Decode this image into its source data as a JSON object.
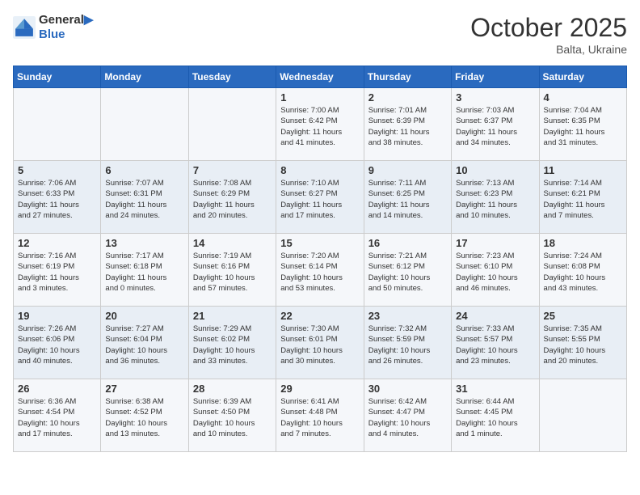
{
  "header": {
    "logo_line1": "General",
    "logo_line2": "Blue",
    "month": "October 2025",
    "location": "Balta, Ukraine"
  },
  "weekdays": [
    "Sunday",
    "Monday",
    "Tuesday",
    "Wednesday",
    "Thursday",
    "Friday",
    "Saturday"
  ],
  "weeks": [
    [
      {
        "day": "",
        "info": ""
      },
      {
        "day": "",
        "info": ""
      },
      {
        "day": "",
        "info": ""
      },
      {
        "day": "1",
        "info": "Sunrise: 7:00 AM\nSunset: 6:42 PM\nDaylight: 11 hours\nand 41 minutes."
      },
      {
        "day": "2",
        "info": "Sunrise: 7:01 AM\nSunset: 6:39 PM\nDaylight: 11 hours\nand 38 minutes."
      },
      {
        "day": "3",
        "info": "Sunrise: 7:03 AM\nSunset: 6:37 PM\nDaylight: 11 hours\nand 34 minutes."
      },
      {
        "day": "4",
        "info": "Sunrise: 7:04 AM\nSunset: 6:35 PM\nDaylight: 11 hours\nand 31 minutes."
      }
    ],
    [
      {
        "day": "5",
        "info": "Sunrise: 7:06 AM\nSunset: 6:33 PM\nDaylight: 11 hours\nand 27 minutes."
      },
      {
        "day": "6",
        "info": "Sunrise: 7:07 AM\nSunset: 6:31 PM\nDaylight: 11 hours\nand 24 minutes."
      },
      {
        "day": "7",
        "info": "Sunrise: 7:08 AM\nSunset: 6:29 PM\nDaylight: 11 hours\nand 20 minutes."
      },
      {
        "day": "8",
        "info": "Sunrise: 7:10 AM\nSunset: 6:27 PM\nDaylight: 11 hours\nand 17 minutes."
      },
      {
        "day": "9",
        "info": "Sunrise: 7:11 AM\nSunset: 6:25 PM\nDaylight: 11 hours\nand 14 minutes."
      },
      {
        "day": "10",
        "info": "Sunrise: 7:13 AM\nSunset: 6:23 PM\nDaylight: 11 hours\nand 10 minutes."
      },
      {
        "day": "11",
        "info": "Sunrise: 7:14 AM\nSunset: 6:21 PM\nDaylight: 11 hours\nand 7 minutes."
      }
    ],
    [
      {
        "day": "12",
        "info": "Sunrise: 7:16 AM\nSunset: 6:19 PM\nDaylight: 11 hours\nand 3 minutes."
      },
      {
        "day": "13",
        "info": "Sunrise: 7:17 AM\nSunset: 6:18 PM\nDaylight: 11 hours\nand 0 minutes."
      },
      {
        "day": "14",
        "info": "Sunrise: 7:19 AM\nSunset: 6:16 PM\nDaylight: 10 hours\nand 57 minutes."
      },
      {
        "day": "15",
        "info": "Sunrise: 7:20 AM\nSunset: 6:14 PM\nDaylight: 10 hours\nand 53 minutes."
      },
      {
        "day": "16",
        "info": "Sunrise: 7:21 AM\nSunset: 6:12 PM\nDaylight: 10 hours\nand 50 minutes."
      },
      {
        "day": "17",
        "info": "Sunrise: 7:23 AM\nSunset: 6:10 PM\nDaylight: 10 hours\nand 46 minutes."
      },
      {
        "day": "18",
        "info": "Sunrise: 7:24 AM\nSunset: 6:08 PM\nDaylight: 10 hours\nand 43 minutes."
      }
    ],
    [
      {
        "day": "19",
        "info": "Sunrise: 7:26 AM\nSunset: 6:06 PM\nDaylight: 10 hours\nand 40 minutes."
      },
      {
        "day": "20",
        "info": "Sunrise: 7:27 AM\nSunset: 6:04 PM\nDaylight: 10 hours\nand 36 minutes."
      },
      {
        "day": "21",
        "info": "Sunrise: 7:29 AM\nSunset: 6:02 PM\nDaylight: 10 hours\nand 33 minutes."
      },
      {
        "day": "22",
        "info": "Sunrise: 7:30 AM\nSunset: 6:01 PM\nDaylight: 10 hours\nand 30 minutes."
      },
      {
        "day": "23",
        "info": "Sunrise: 7:32 AM\nSunset: 5:59 PM\nDaylight: 10 hours\nand 26 minutes."
      },
      {
        "day": "24",
        "info": "Sunrise: 7:33 AM\nSunset: 5:57 PM\nDaylight: 10 hours\nand 23 minutes."
      },
      {
        "day": "25",
        "info": "Sunrise: 7:35 AM\nSunset: 5:55 PM\nDaylight: 10 hours\nand 20 minutes."
      }
    ],
    [
      {
        "day": "26",
        "info": "Sunrise: 6:36 AM\nSunset: 4:54 PM\nDaylight: 10 hours\nand 17 minutes."
      },
      {
        "day": "27",
        "info": "Sunrise: 6:38 AM\nSunset: 4:52 PM\nDaylight: 10 hours\nand 13 minutes."
      },
      {
        "day": "28",
        "info": "Sunrise: 6:39 AM\nSunset: 4:50 PM\nDaylight: 10 hours\nand 10 minutes."
      },
      {
        "day": "29",
        "info": "Sunrise: 6:41 AM\nSunset: 4:48 PM\nDaylight: 10 hours\nand 7 minutes."
      },
      {
        "day": "30",
        "info": "Sunrise: 6:42 AM\nSunset: 4:47 PM\nDaylight: 10 hours\nand 4 minutes."
      },
      {
        "day": "31",
        "info": "Sunrise: 6:44 AM\nSunset: 4:45 PM\nDaylight: 10 hours\nand 1 minute."
      },
      {
        "day": "",
        "info": ""
      }
    ]
  ]
}
